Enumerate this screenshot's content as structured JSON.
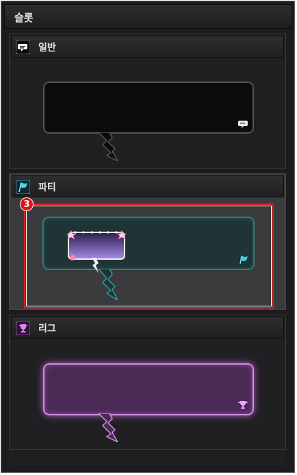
{
  "panel": {
    "title": "슬롯"
  },
  "sections": [
    {
      "label": "일반",
      "icon": "speech-bubble-icon"
    },
    {
      "label": "파티",
      "icon": "party-flag-icon"
    },
    {
      "label": "리그",
      "icon": "trophy-icon"
    }
  ],
  "selection": {
    "badge": "3",
    "selected_section": "파티"
  },
  "colors": {
    "normal_border": "#555555",
    "party_border": "#2f7a7a",
    "league_border": "#d48ae6",
    "selection_red": "#e01f1f",
    "badge_red": "#d8161b"
  }
}
